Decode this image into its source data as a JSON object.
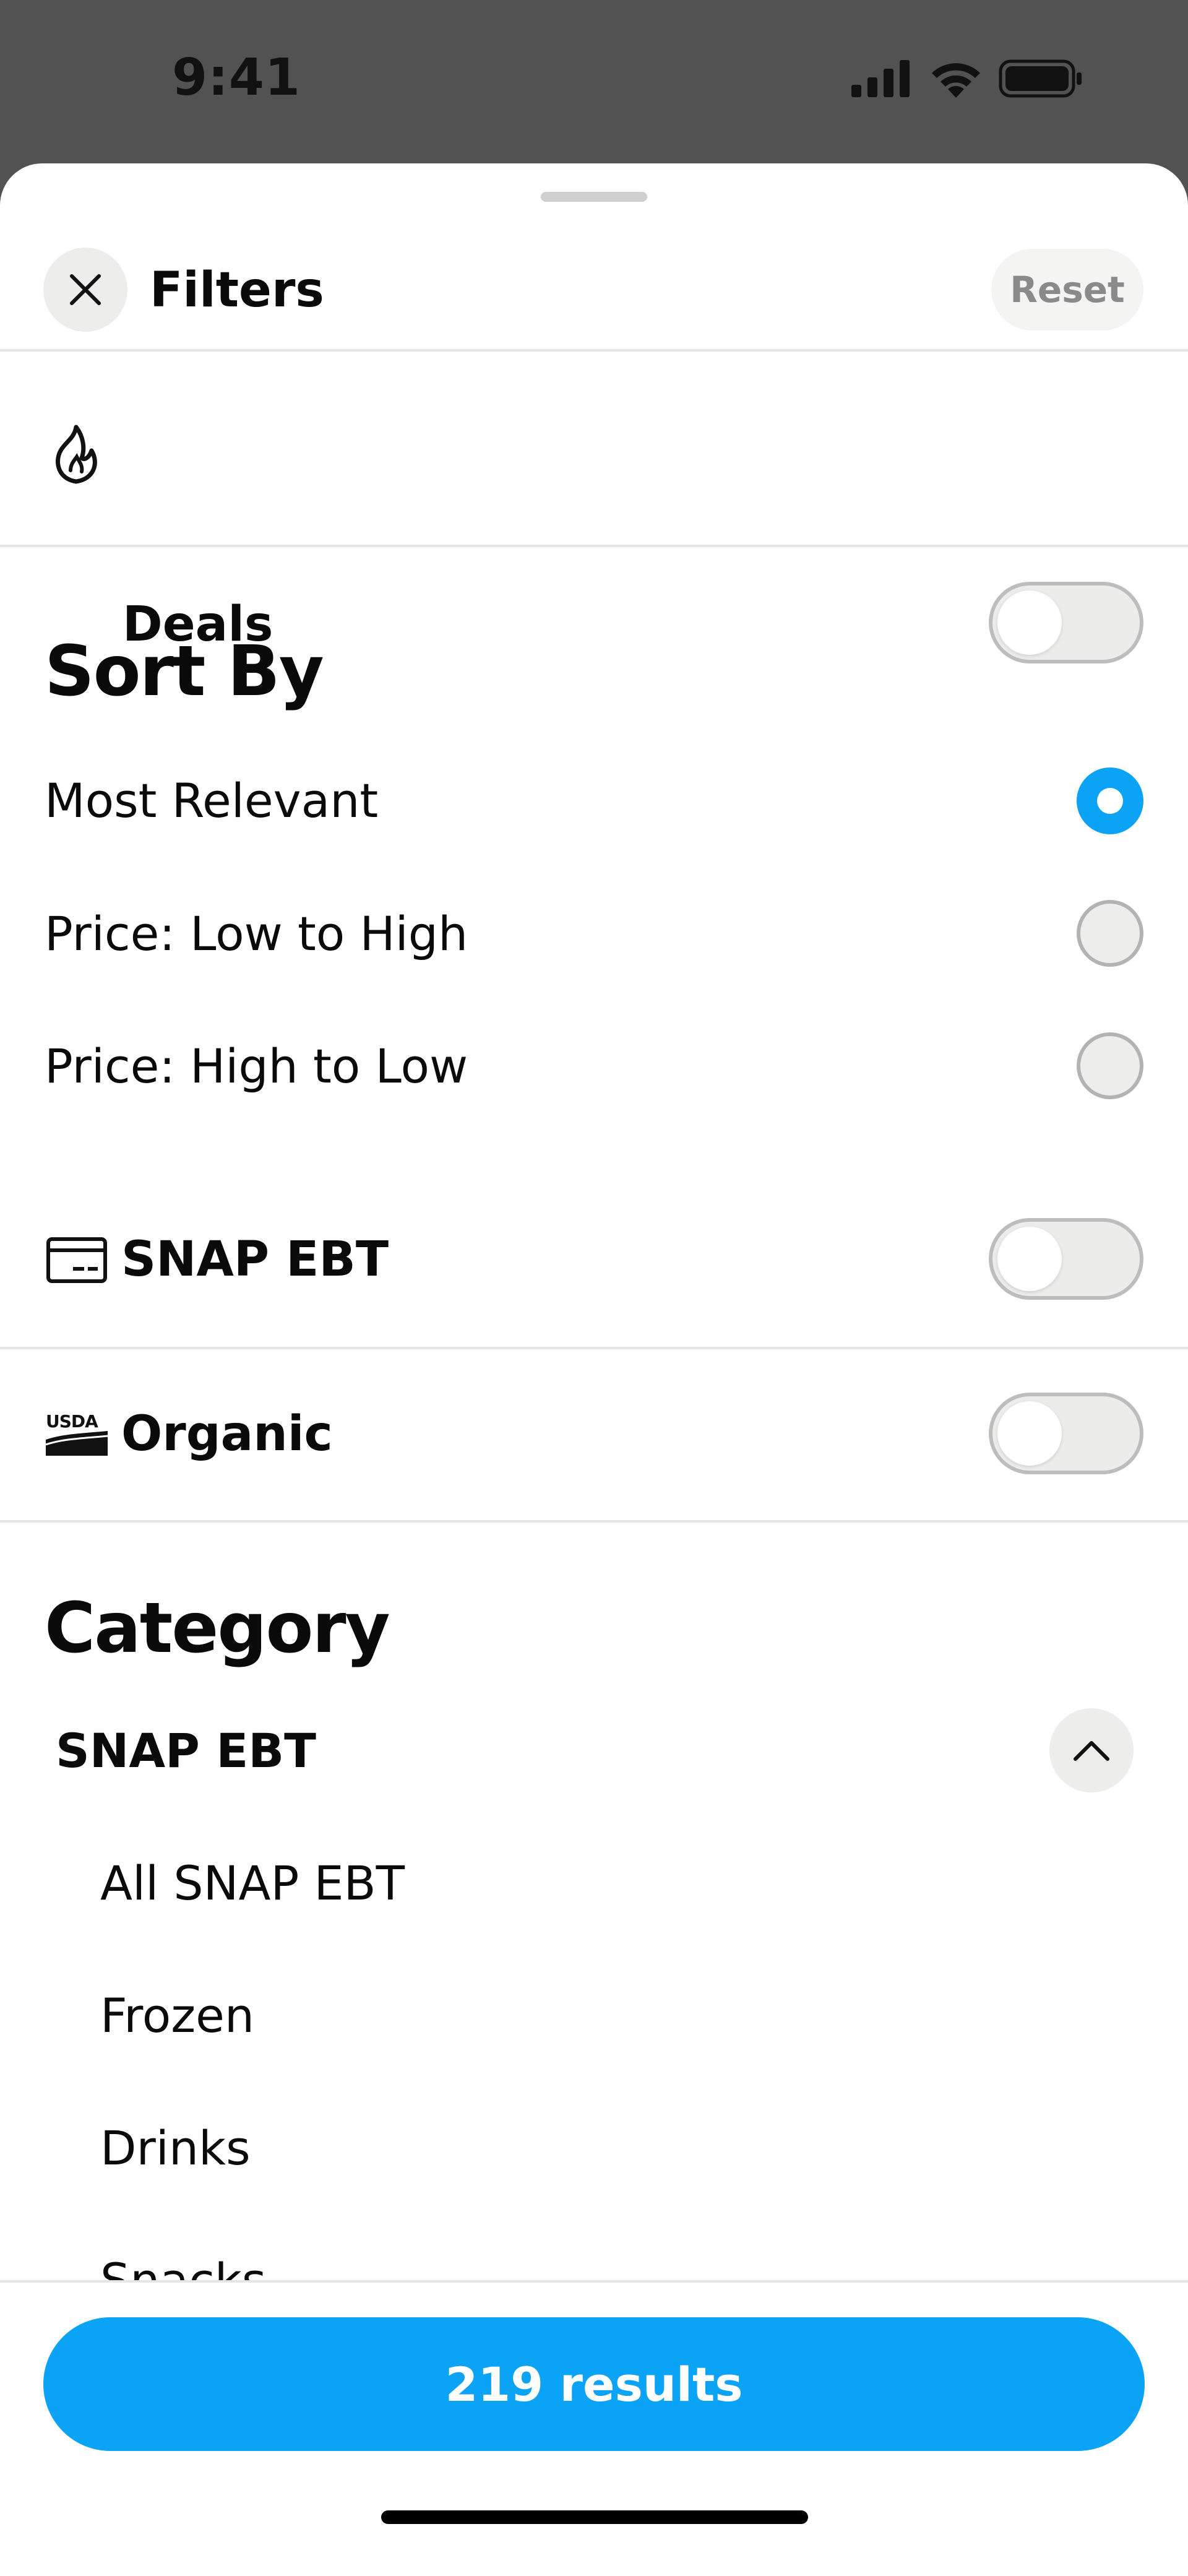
{
  "status_bar": {
    "time": "9:41",
    "icons": [
      "signal-icon",
      "wifi-icon",
      "battery-icon"
    ]
  },
  "header": {
    "title": "Filters",
    "reset_label": "Reset",
    "close_icon": "close-icon"
  },
  "deals": {
    "label": "Deals",
    "icon": "flame-icon",
    "enabled": false
  },
  "sort": {
    "heading": "Sort By",
    "options": [
      {
        "label": "Most Relevant",
        "selected": true
      },
      {
        "label": "Price: Low to High",
        "selected": false
      },
      {
        "label": "Price: High to Low",
        "selected": false
      }
    ]
  },
  "snap": {
    "label": "SNAP EBT",
    "icon": "card-icon",
    "enabled": false
  },
  "organic": {
    "label": "Organic",
    "icon": "usda-icon",
    "icon_text": "USDA",
    "enabled": false
  },
  "category": {
    "heading": "Category",
    "group": {
      "label": "SNAP EBT",
      "expanded": true,
      "items": [
        "All SNAP EBT",
        "Frozen",
        "Drinks",
        "Snacks"
      ]
    }
  },
  "footer": {
    "results_label": "219 results"
  },
  "colors": {
    "accent": "#0aa3f5",
    "status_bar_bg": "#525252",
    "toggle_off": "#ececea"
  }
}
